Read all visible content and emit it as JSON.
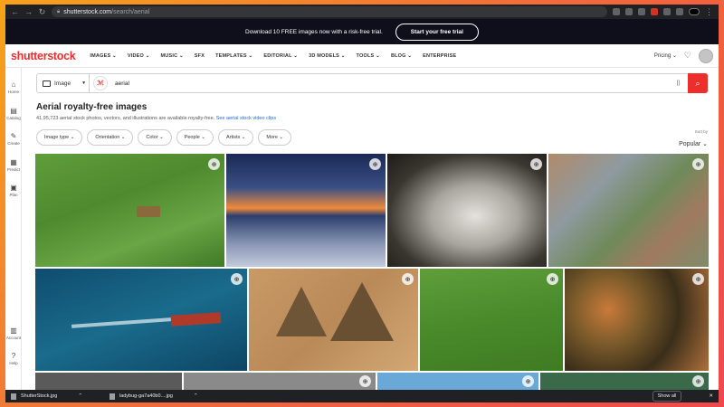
{
  "browser": {
    "url_host": "shutterstock.com",
    "url_path": "/search/aerial"
  },
  "promo": {
    "text": "Download 10 FREE images now with a risk-free trial.",
    "button": "Start your free trial"
  },
  "nav": {
    "logo": "shutterstock",
    "items": [
      "IMAGES ⌄",
      "VIDEO ⌄",
      "MUSIC ⌄",
      "SFX",
      "TEMPLATES ⌄",
      "EDITORIAL ⌄",
      "3D MODELS ⌄",
      "TOOLS ⌄",
      "BLOG ⌄",
      "ENTERPRISE"
    ],
    "pricing": "Pricing ⌄"
  },
  "sidebar": {
    "items": [
      {
        "label": "Home",
        "icon": "home-icon",
        "glyph": "⌂"
      },
      {
        "label": "Catalog",
        "icon": "catalog-icon",
        "glyph": "▤"
      },
      {
        "label": "Create",
        "icon": "create-icon",
        "glyph": "✎"
      },
      {
        "label": "Predict",
        "icon": "predict-icon",
        "glyph": "▦"
      },
      {
        "label": "Plan",
        "icon": "plan-icon",
        "glyph": "▣"
      },
      {
        "label": "Account",
        "icon": "account-icon",
        "glyph": "▥"
      },
      {
        "label": "Help",
        "icon": "help-icon",
        "glyph": "?"
      }
    ]
  },
  "search": {
    "type": "Image",
    "query": "aerial"
  },
  "results": {
    "title": "Aerial royalty-free images",
    "count_text": "41,95,723 aerial stock photos, vectors, and illustrations are available royalty-free.",
    "video_link": "See aerial stock video clips",
    "sort_label": "Sort by",
    "sort_value": "Popular ⌄"
  },
  "filters": [
    "Image type ⌄",
    "Orientation ⌄",
    "Color ⌄",
    "People ⌄",
    "Artists ⌄",
    "More ⌄"
  ],
  "downloads": {
    "items": [
      "ShutterStock.jpg",
      "ladybug-ga7a40b0....jpg"
    ],
    "show_all": "Show all"
  }
}
